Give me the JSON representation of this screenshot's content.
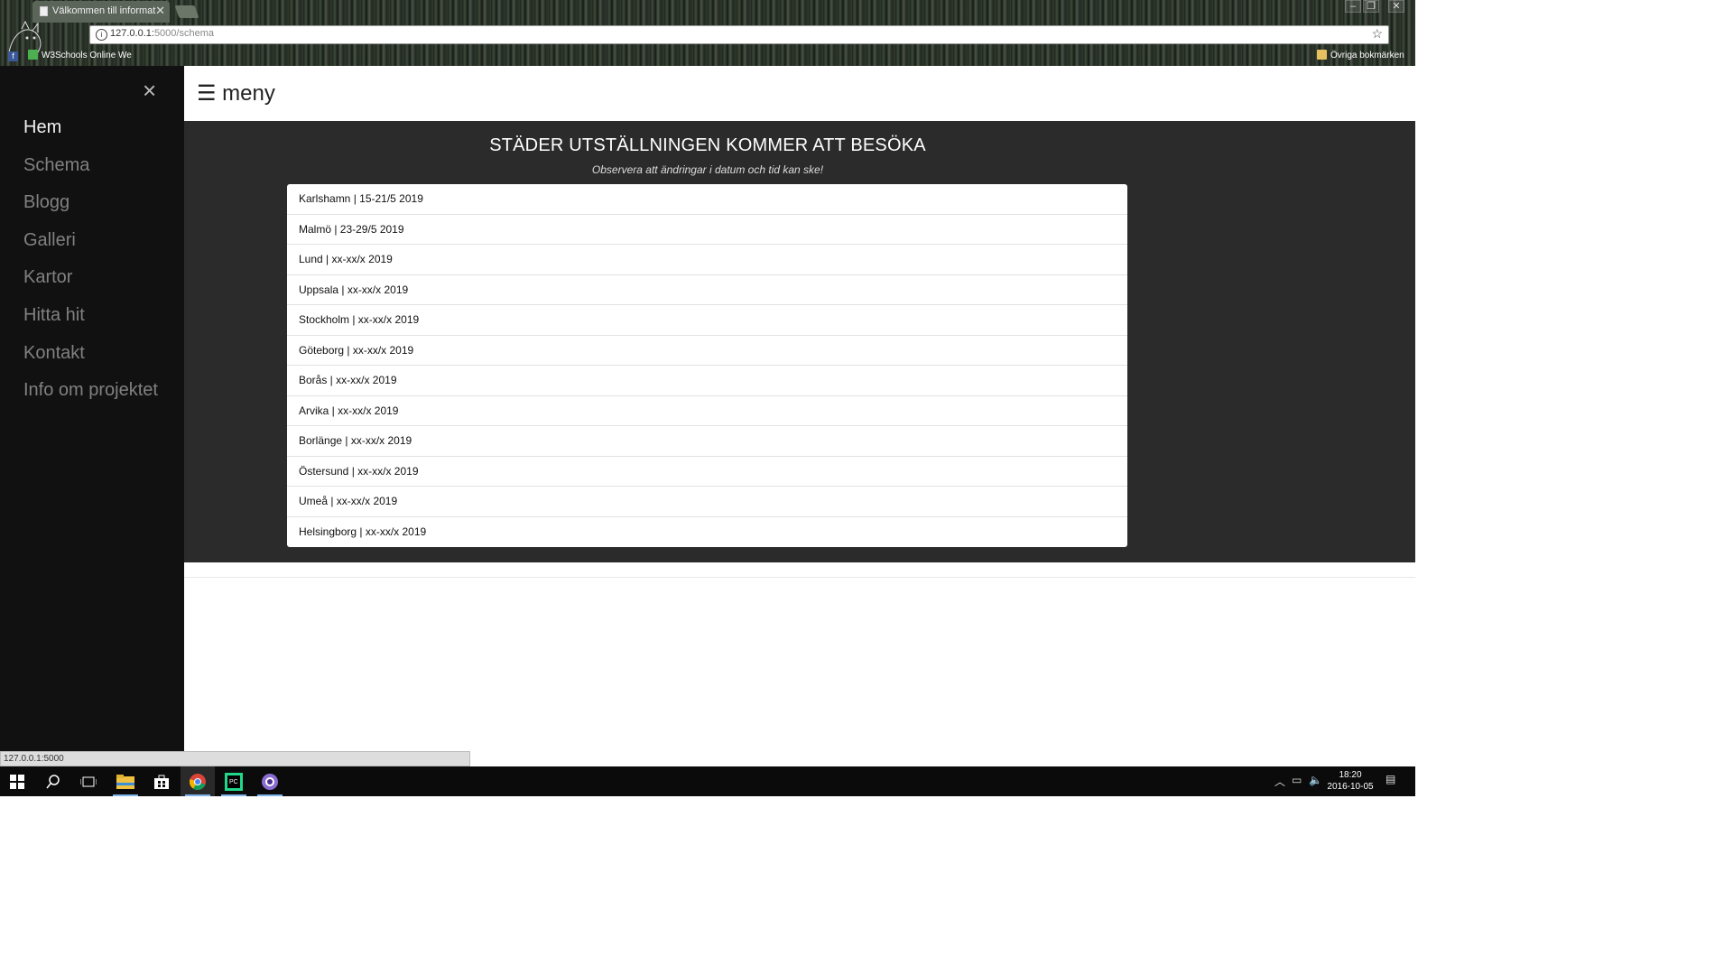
{
  "browser": {
    "tab_title": "Välkommen till informati",
    "url_host": "127.0.0.1:",
    "url_path": "5000/schema",
    "bookmarks": [
      "W3Schools Online We"
    ],
    "other_bookmarks": "Övriga bokmärken"
  },
  "sidebar": {
    "items": [
      {
        "label": "Hem",
        "active": true
      },
      {
        "label": "Schema"
      },
      {
        "label": "Blogg"
      },
      {
        "label": "Galleri"
      },
      {
        "label": "Kartor"
      },
      {
        "label": "Hitta hit"
      },
      {
        "label": "Kontakt"
      },
      {
        "label": "Info om projektet"
      }
    ]
  },
  "topbar": {
    "menu_label": "☰ meny"
  },
  "main": {
    "heading": "STÄDER UTSTÄLLNINGEN KOMMER ATT BESÖKA",
    "note": "Observera att ändringar i datum och tid kan ske!",
    "cities": [
      "Karlshamn | 15-21/5 2019",
      "Malmö | 23-29/5 2019",
      "Lund | xx-xx/x 2019",
      "Uppsala | xx-xx/x 2019",
      "Stockholm | xx-xx/x 2019",
      "Göteborg | xx-xx/x 2019",
      "Borås | xx-xx/x 2019",
      "Arvika | xx-xx/x 2019",
      "Borlänge | xx-xx/x 2019",
      "Östersund | xx-xx/x 2019",
      "Umeå | xx-xx/x 2019",
      "Helsingborg | xx-xx/x 2019"
    ]
  },
  "status_bar": "127.0.0.1:5000",
  "taskbar": {
    "time": "18:20",
    "date": "2016-10-05"
  },
  "colors": {
    "sidebar_bg": "#111111",
    "band_bg": "#2b2b2b",
    "sidebar_text": "#818181",
    "sidebar_active": "#f1f1f1"
  }
}
